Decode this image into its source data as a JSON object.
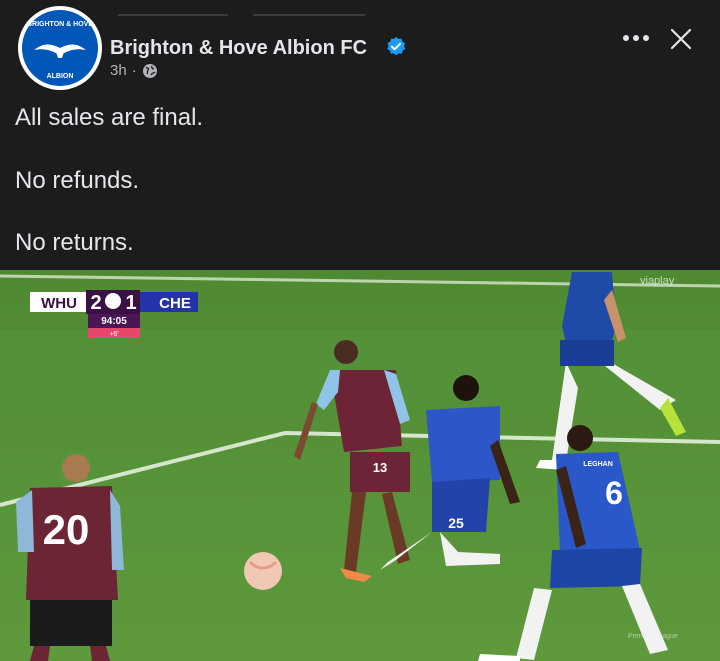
{
  "post": {
    "page_name": "Brighton & Hove Albion FC",
    "time": "3h",
    "separator": "·",
    "avatar_text_top": "BRIGHTON & HOVE",
    "avatar_text_bottom": "ALBION",
    "caption_lines": [
      "All sales are final.",
      "No refunds.",
      "No returns."
    ]
  },
  "icons": {
    "verified": "verified-badge-icon",
    "audience": "globe-icon",
    "more": "more-options-icon",
    "close": "close-icon"
  },
  "colors": {
    "background": "#1c1c1d",
    "text": "#e4e6eb",
    "muted": "#b0b3b8",
    "verified": "#1d9bf0",
    "brand": "#0057b8"
  },
  "scoreboard": {
    "home": "WHU",
    "home_score": "2",
    "away_score": "1",
    "away": "CHE",
    "clock": "94:05",
    "added_time": "+6'"
  },
  "broadcaster": "viaplay",
  "players": {
    "home_shirt_number": "20",
    "home_runner_number": "13",
    "away_kneeling_number": "25",
    "away_shirt_number": "6",
    "away_name_on_back": "LEGHAN"
  }
}
